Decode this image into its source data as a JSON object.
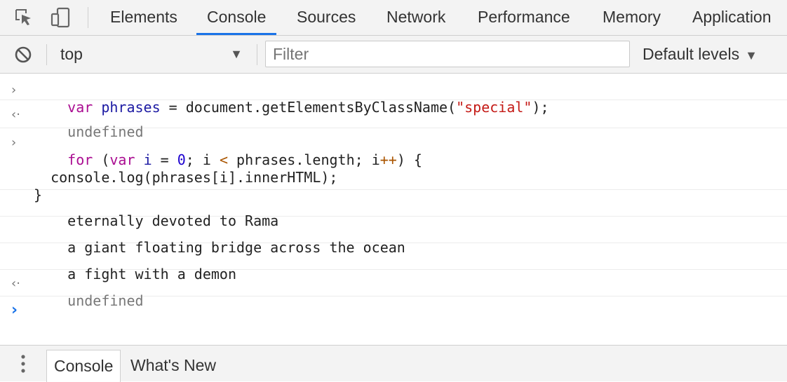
{
  "tabs": [
    {
      "label": "Elements"
    },
    {
      "label": "Console"
    },
    {
      "label": "Sources"
    },
    {
      "label": "Network"
    },
    {
      "label": "Performance"
    },
    {
      "label": "Memory"
    },
    {
      "label": "Application"
    }
  ],
  "active_tab": "Console",
  "icons": {
    "inspect": "inspect-element-icon",
    "device": "device-toolbar-icon",
    "clear": "clear-console-icon",
    "dropdown": "dropdown-triangle-icon",
    "kebab": "more-options-icon"
  },
  "toolbar": {
    "context": "top",
    "filter_placeholder": "Filter",
    "levels": "Default levels"
  },
  "console": {
    "line1": {
      "kw_var": "var",
      "var_name": "phrases",
      "eq": " = ",
      "call": "document.getElementsByClassName(",
      "str": "\"special\"",
      "end": ");"
    },
    "result1": "undefined",
    "loop": {
      "kw_for": "for",
      "open": " (",
      "kw_var": "var",
      "space": " ",
      "i": "i",
      "assign": " = ",
      "zero": "0",
      "cond": "; i ",
      "lt": "<",
      "len": " phrases.length; i",
      "inc": "++",
      "close": ") {",
      "body": "  console.log(phrases[i].innerHTML);",
      "end": "}"
    },
    "outputs": [
      "eternally devoted to Rama",
      "a giant floating bridge across the ocean",
      "a fight with a demon"
    ],
    "result2": "undefined",
    "prompt": "›",
    "input_marker": "›",
    "result_marker": "‹·"
  },
  "drawer": {
    "tabs": [
      {
        "label": "Console"
      },
      {
        "label": "What's New"
      }
    ]
  },
  "colors": {
    "accent": "#1a73e8",
    "keyword": "#aa0d91",
    "variable": "#1c1aa3",
    "string": "#c41a16",
    "prompt": "#1a73e8"
  }
}
